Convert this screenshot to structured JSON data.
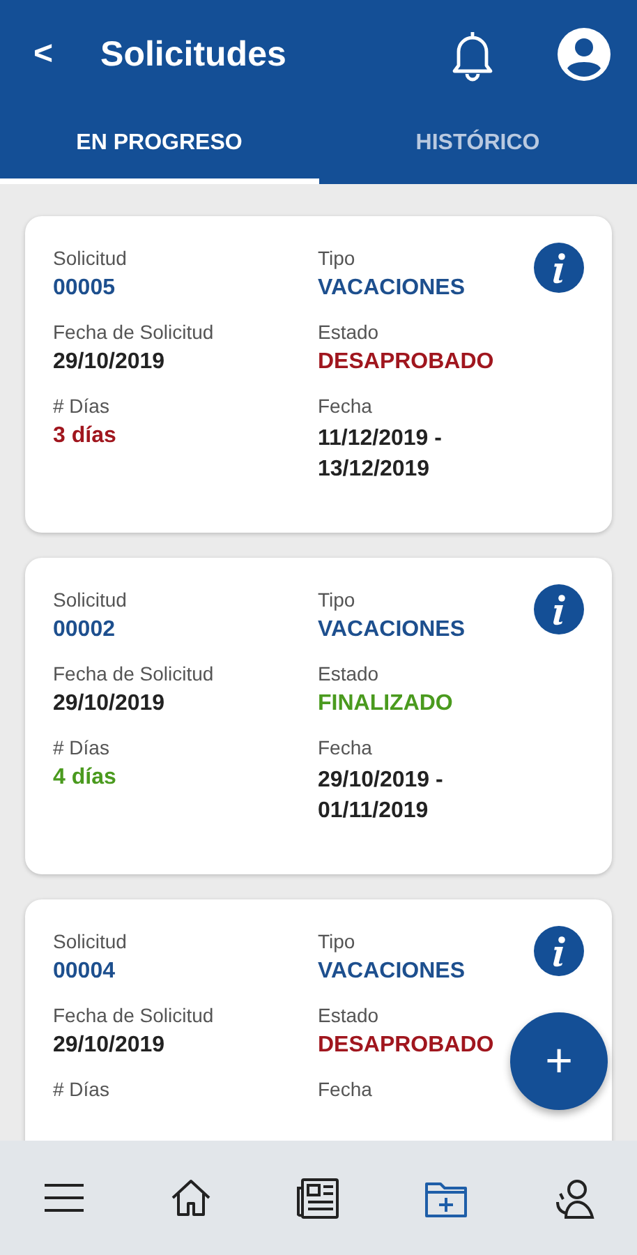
{
  "header": {
    "back": "<",
    "title": "Solicitudes"
  },
  "tabs": [
    {
      "label": "EN PROGRESO",
      "selected": true
    },
    {
      "label": "HISTÓRICO",
      "selected": false
    }
  ],
  "requests": [
    {
      "solicitud_label": "Solicitud",
      "solicitud": "00005",
      "tipo_label": "Tipo",
      "tipo": "VACACIONES",
      "fecha_solicitud_label": "Fecha de Solicitud",
      "fecha_solicitud": "29/10/2019",
      "estado_label": "Estado",
      "estado": "DESAPROBADO",
      "kind": "rejected",
      "dias_label": "# Días",
      "dias": "3 días",
      "fecha_label": "Fecha",
      "fecha": "11/12/2019 - 13/12/2019"
    },
    {
      "solicitud_label": "Solicitud",
      "solicitud": "00002",
      "tipo_label": "Tipo",
      "tipo": "VACACIONES",
      "fecha_solicitud_label": "Fecha de Solicitud",
      "fecha_solicitud": "29/10/2019",
      "estado_label": "Estado",
      "estado": "FINALIZADO",
      "kind": "approved",
      "dias_label": "# Días",
      "dias": "4 días",
      "fecha_label": "Fecha",
      "fecha": "29/10/2019 - 01/11/2019"
    },
    {
      "solicitud_label": "Solicitud",
      "solicitud": "00004",
      "tipo_label": "Tipo",
      "tipo": "VACACIONES",
      "fecha_solicitud_label": "Fecha de Solicitud",
      "fecha_solicitud": "29/10/2019",
      "estado_label": "Estado",
      "estado": "DESAPROBADO",
      "kind": "rejected",
      "dias_label": "# Días",
      "fecha_label": "Fecha"
    }
  ],
  "fab": "+",
  "nav": [
    {
      "kind": "menu",
      "selected": false
    },
    {
      "kind": "home",
      "selected": false
    },
    {
      "kind": "news",
      "selected": false
    },
    {
      "kind": "folder",
      "selected": true
    },
    {
      "kind": "profile",
      "selected": false
    }
  ]
}
